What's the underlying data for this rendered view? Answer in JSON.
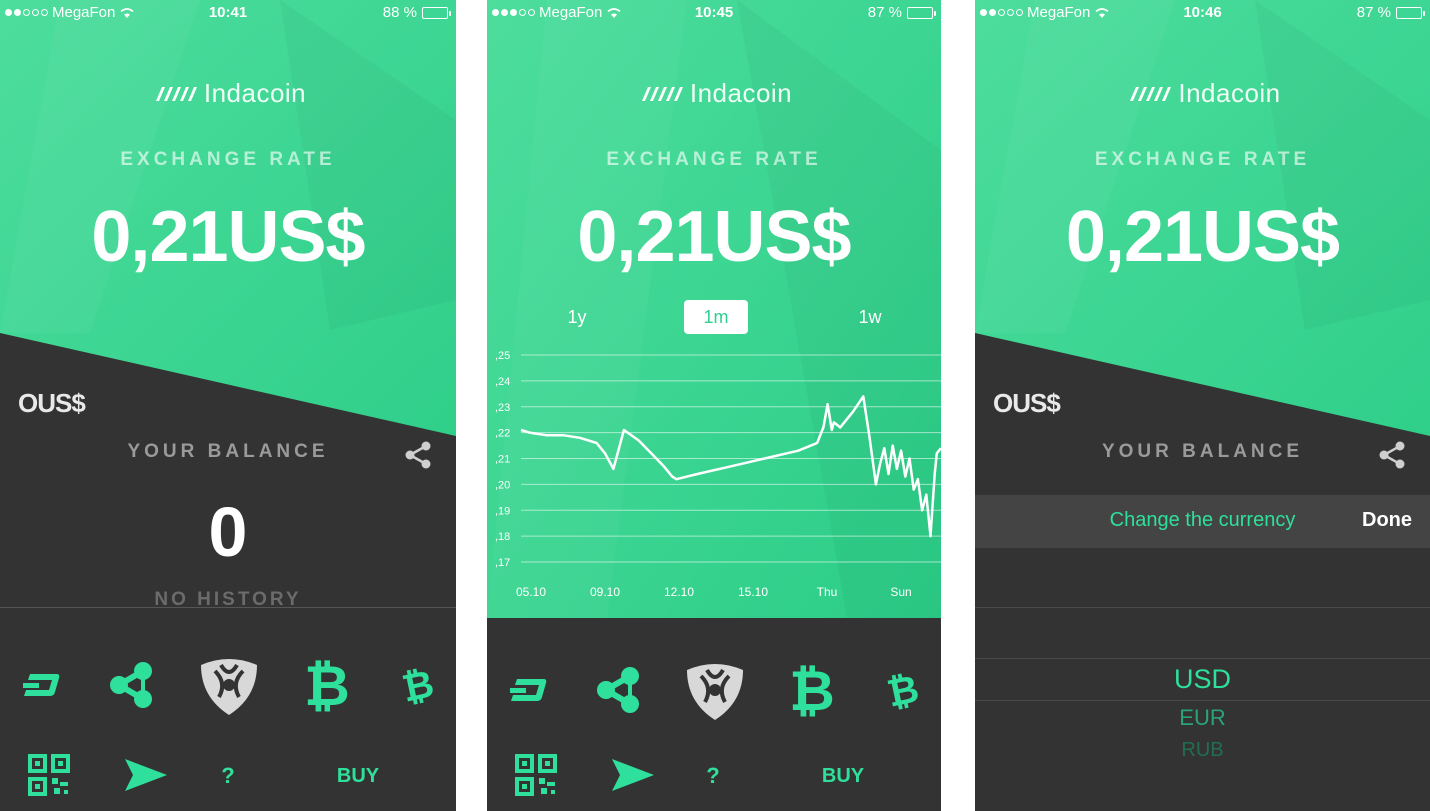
{
  "colors": {
    "green": "#36d391",
    "green_light": "#4ddd9d",
    "dark": "#333333",
    "accent": "#2ee09b"
  },
  "screens": [
    {
      "status": {
        "carrier": "MegaFon",
        "time": "10:41",
        "battery": "88 %",
        "battery_level": 0.88
      },
      "logo": "Indacoin",
      "rate_label": "EXCHANGE RATE",
      "rate_value": "0,21US$",
      "currency_partial": "OUS$",
      "balance_label": "YOUR BALANCE",
      "balance_value": "0",
      "history": "NO HISTORY",
      "coins": [
        "dash-icon",
        "ripple-icon",
        "nem-icon",
        "bitcoin-icon",
        "bitcoin-cash-icon"
      ],
      "actions": {
        "qr": "qr-code-icon",
        "send": "send-icon",
        "help": "?",
        "buy": "BUY"
      }
    },
    {
      "status": {
        "carrier": "MegaFon",
        "time": "10:45",
        "battery": "87 %",
        "battery_level": 0.87
      },
      "logo": "Indacoin",
      "rate_label": "EXCHANGE RATE",
      "rate_value": "0,21US$",
      "tabs": [
        "1y",
        "1m",
        "1w"
      ],
      "active_tab": "1m",
      "actions": {
        "qr": "qr-code-icon",
        "send": "send-icon",
        "help": "?",
        "buy": "BUY"
      }
    },
    {
      "status": {
        "carrier": "MegaFon",
        "time": "10:46",
        "battery": "87 %",
        "battery_level": 0.87
      },
      "logo": "Indacoin",
      "rate_label": "EXCHANGE RATE",
      "rate_value": "0,21US$",
      "currency_partial": "OUS$",
      "balance_label": "YOUR BALANCE",
      "picker": {
        "title": "Change the currency",
        "done": "Done",
        "options": [
          "USD",
          "EUR",
          "RUB"
        ],
        "selected": "USD"
      }
    }
  ],
  "chart_data": {
    "type": "line",
    "title": "",
    "xlabel": "",
    "ylabel": "",
    "x_ticks": [
      "05.10",
      "09.10",
      "12.10",
      "15.10",
      "Thu",
      "Sun"
    ],
    "y_ticks": [
      ",25",
      ",24",
      ",23",
      ",22",
      ",21",
      ",20",
      ",19",
      ",18",
      ",17"
    ],
    "ylim": [
      0.17,
      0.25
    ],
    "grid": true,
    "series": [
      {
        "points": [
          [
            0.0,
            0.221
          ],
          [
            0.02,
            0.22
          ],
          [
            0.06,
            0.219
          ],
          [
            0.1,
            0.219
          ],
          [
            0.14,
            0.218
          ],
          [
            0.18,
            0.216
          ],
          [
            0.2,
            0.212
          ],
          [
            0.22,
            0.206
          ],
          [
            0.245,
            0.221
          ],
          [
            0.28,
            0.217
          ],
          [
            0.31,
            0.212
          ],
          [
            0.34,
            0.207
          ],
          [
            0.36,
            0.203
          ],
          [
            0.37,
            0.202
          ],
          [
            0.42,
            0.204
          ],
          [
            0.5,
            0.207
          ],
          [
            0.58,
            0.21
          ],
          [
            0.66,
            0.213
          ],
          [
            0.705,
            0.216
          ],
          [
            0.72,
            0.222
          ],
          [
            0.73,
            0.231
          ],
          [
            0.74,
            0.221
          ],
          [
            0.745,
            0.224
          ],
          [
            0.76,
            0.222
          ],
          [
            0.79,
            0.228
          ],
          [
            0.815,
            0.234
          ],
          [
            0.83,
            0.218
          ],
          [
            0.845,
            0.2
          ],
          [
            0.855,
            0.208
          ],
          [
            0.865,
            0.214
          ],
          [
            0.875,
            0.204
          ],
          [
            0.885,
            0.215
          ],
          [
            0.895,
            0.206
          ],
          [
            0.905,
            0.213
          ],
          [
            0.915,
            0.203
          ],
          [
            0.925,
            0.21
          ],
          [
            0.935,
            0.198
          ],
          [
            0.945,
            0.202
          ],
          [
            0.955,
            0.19
          ],
          [
            0.965,
            0.196
          ],
          [
            0.975,
            0.18
          ],
          [
            0.985,
            0.204
          ],
          [
            0.99,
            0.212
          ],
          [
            1.0,
            0.214
          ]
        ]
      }
    ]
  }
}
